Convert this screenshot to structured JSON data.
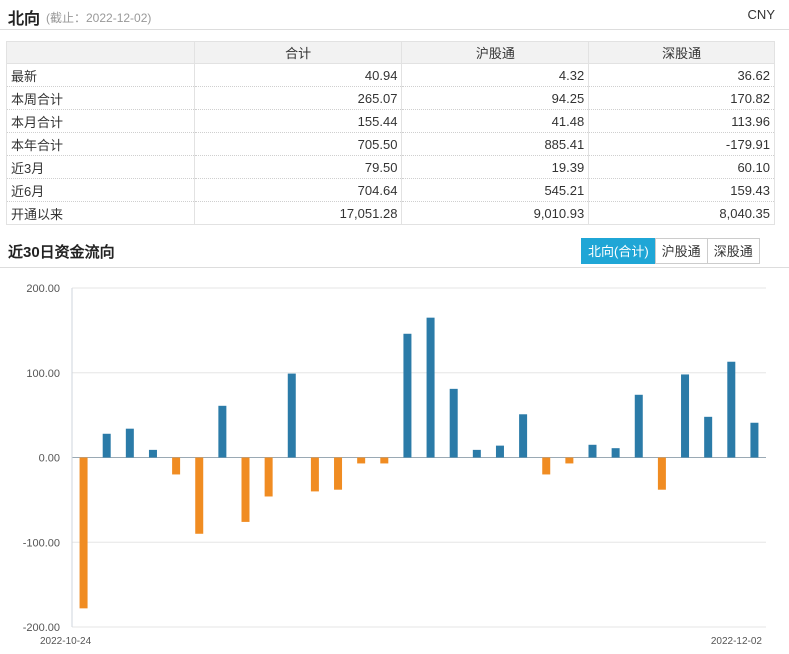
{
  "header": {
    "title": "北向",
    "subtitle": "(截止：2022-12-02)",
    "currency": "CNY"
  },
  "table": {
    "columns": [
      "",
      "合计",
      "沪股通",
      "深股通"
    ],
    "rows": [
      {
        "label": "最新",
        "values": [
          "40.94",
          "4.32",
          "36.62"
        ]
      },
      {
        "label": "本周合计",
        "values": [
          "265.07",
          "94.25",
          "170.82"
        ]
      },
      {
        "label": "本月合计",
        "values": [
          "155.44",
          "41.48",
          "113.96"
        ]
      },
      {
        "label": "本年合计",
        "values": [
          "705.50",
          "885.41",
          "-179.91"
        ]
      },
      {
        "label": "近3月",
        "values": [
          "79.50",
          "19.39",
          "60.10"
        ]
      },
      {
        "label": "近6月",
        "values": [
          "704.64",
          "545.21",
          "159.43"
        ]
      },
      {
        "label": "开通以来",
        "values": [
          "17,051.28",
          "9,010.93",
          "8,040.35"
        ]
      }
    ]
  },
  "section": {
    "title": "近30日资金流向"
  },
  "tabs": [
    {
      "label": "北向(合计)",
      "active": true
    },
    {
      "label": "沪股通",
      "active": false
    },
    {
      "label": "深股通",
      "active": false
    }
  ],
  "chart_data": {
    "type": "bar",
    "x_first_label": "2022-10-24",
    "x_last_label": "2022-12-02",
    "ylim": [
      -200,
      200
    ],
    "yticks": [
      "200.00",
      "100.00",
      "0.00",
      "-100.00",
      "-200.00"
    ],
    "grid": true,
    "colors": {
      "positive": "#2b7ba8",
      "negative": "#f08c22"
    },
    "values": [
      -178,
      28,
      34,
      9,
      -20,
      -90,
      61,
      -76,
      -46,
      99,
      -40,
      -38,
      -7,
      -7,
      146,
      165,
      81,
      9,
      14,
      51,
      -20,
      -7,
      15,
      11,
      74,
      -38,
      98,
      48,
      113,
      41
    ]
  }
}
